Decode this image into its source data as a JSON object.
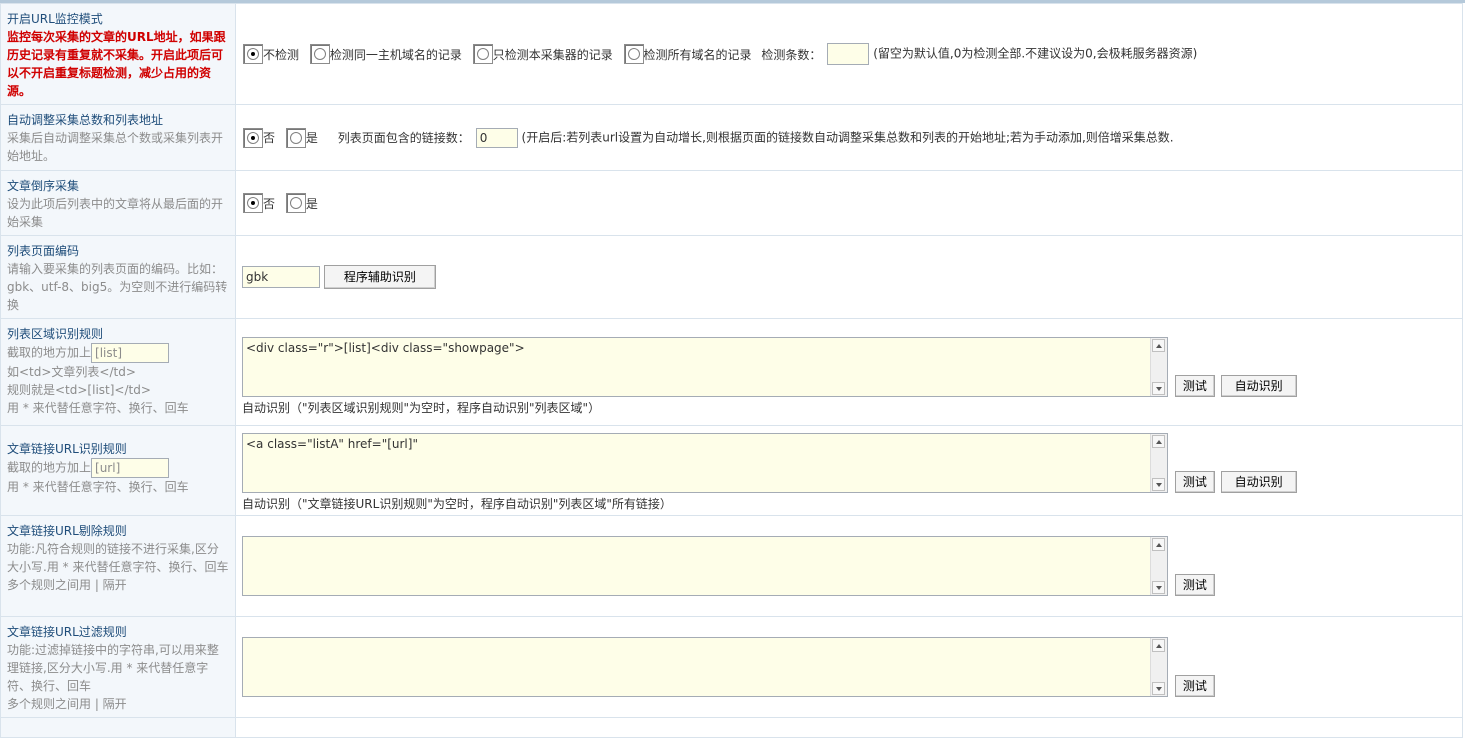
{
  "rows": {
    "url_monitor": {
      "title": "开启URL监控模式",
      "desc": "监控每次采集的文章的URL地址，如果跟历史记录有重复就不采集。开启此项后可以不开启重复标题检测，减少占用的资源。",
      "options": [
        "不检测",
        "检测同一主机域名的记录",
        "只检测本采集器的记录",
        "检测所有域名的记录"
      ],
      "selected": 0,
      "count_label": "检测条数：",
      "count_value": "",
      "hint": "(留空为默认值,0为检测全部.不建议设为0,会极耗服务器资源)"
    },
    "auto_adjust": {
      "title": "自动调整采集总数和列表地址",
      "desc": "采集后自动调整采集总个数或采集列表开始地址。",
      "options": [
        "否",
        "是"
      ],
      "selected": 0,
      "links_label": "列表页面包含的链接数：",
      "links_value": "0",
      "hint": "(开启后:若列表url设置为自动增长,则根据页面的链接数自动调整采集总数和列表的开始地址;若为手动添加,则倍增采集总数."
    },
    "reverse": {
      "title": "文章倒序采集",
      "desc": "设为此项后列表中的文章将从最后面的开始采集",
      "options": [
        "否",
        "是"
      ],
      "selected": 0
    },
    "encoding": {
      "title": "列表页面编码",
      "desc": "请输入要采集的列表页面的编码。比如：gbk、utf-8、big5。为空则不进行编码转换",
      "value": "gbk",
      "button": "程序辅助识别"
    },
    "list_area": {
      "title": "列表区域识别规则",
      "desc1": "截取的地方加上",
      "placeholder": "[list]",
      "desc2": "如<td>文章列表</td>",
      "desc3": "规则就是<td>[list]</td>",
      "desc4": "用 * 来代替任意字符、换行、回车",
      "content": "<div class=\"r\">[list]<div class=\"showpage\">",
      "test": "测试",
      "auto": "自动识别",
      "note": "自动识别（\"列表区域识别规则\"为空时，程序自动识别\"列表区域\"）"
    },
    "link_rule": {
      "title": "文章链接URL识别规则",
      "desc1": "截取的地方加上",
      "placeholder": "[url]",
      "desc2": "用 * 来代替任意字符、换行、回车",
      "content": "<a class=\"listA\" href=\"[url]\"",
      "test": "测试",
      "auto": "自动识别",
      "note": "自动识别（\"文章链接URL识别规则\"为空时，程序自动识别\"列表区域\"所有链接）"
    },
    "link_exclude": {
      "title": "文章链接URL剔除规则",
      "desc1": "功能:凡符合规则的链接不进行采集,区分大小写.用 * 来代替任意字符、换行、回车",
      "desc2": "多个规则之间用 | 隔开",
      "content": "",
      "test": "测试"
    },
    "link_filter": {
      "title": "文章链接URL过滤规则",
      "desc1": "功能:过滤掉链接中的字符串,可以用来整理链接,区分大小写.用 * 来代替任意字符、换行、回车",
      "desc2": "多个规则之间用 | 隔开",
      "content": "",
      "test": "测试"
    }
  }
}
